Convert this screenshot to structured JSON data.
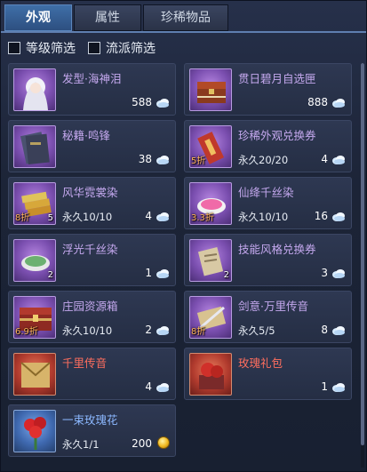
{
  "tabs": [
    {
      "label": "外观",
      "active": true
    },
    {
      "label": "属性",
      "active": false
    },
    {
      "label": "珍稀物品",
      "active": false
    }
  ],
  "filters": [
    {
      "label": "等级筛选",
      "checked": false
    },
    {
      "label": "流派筛选",
      "checked": false
    }
  ],
  "items": [
    {
      "name": "发型·海神泪",
      "rarity": "purple",
      "icon": "hair-portrait-icon",
      "badge": "",
      "count": "",
      "duration": "",
      "price": "588",
      "currency": "cloud-crystal-icon"
    },
    {
      "name": "贯日碧月自选匣",
      "rarity": "purple",
      "icon": "treasure-chest-icon",
      "badge": "",
      "count": "",
      "duration": "",
      "price": "888",
      "currency": "cloud-crystal-icon"
    },
    {
      "name": "秘籍·鸣锋",
      "rarity": "purple",
      "icon": "secret-book-icon",
      "badge": "",
      "count": "",
      "duration": "",
      "price": "38",
      "currency": "cloud-crystal-icon"
    },
    {
      "name": "珍稀外观兑换券",
      "rarity": "purple",
      "icon": "red-ticket-icon",
      "badge": "5折",
      "count": "",
      "duration": "永久20/20",
      "price": "4",
      "currency": "cloud-crystal-icon"
    },
    {
      "name": "风华霓裳染",
      "rarity": "purple",
      "icon": "dye-cloth-icon",
      "badge": "8折",
      "count": "5",
      "duration": "永久10/10",
      "price": "4",
      "currency": "cloud-crystal-icon"
    },
    {
      "name": "仙绛千丝染",
      "rarity": "purple",
      "icon": "dye-bowl-pink-icon",
      "badge": "3.3折",
      "count": "",
      "duration": "永久10/10",
      "price": "16",
      "currency": "cloud-crystal-icon"
    },
    {
      "name": "浮光千丝染",
      "rarity": "purple",
      "icon": "dye-bowl-green-icon",
      "badge": "",
      "count": "2",
      "duration": "",
      "price": "1",
      "currency": "cloud-crystal-icon"
    },
    {
      "name": "技能风格兑换券",
      "rarity": "purple",
      "icon": "paper-ticket-icon",
      "badge": "",
      "count": "2",
      "duration": "",
      "price": "3",
      "currency": "cloud-crystal-icon"
    },
    {
      "name": "庄园资源箱",
      "rarity": "purple",
      "icon": "resource-chest-icon",
      "badge": "6.9折",
      "count": "",
      "duration": "永久10/10",
      "price": "2",
      "currency": "cloud-crystal-icon"
    },
    {
      "name": "剑意·万里传音",
      "rarity": "purple",
      "icon": "sword-scroll-icon",
      "badge": "8折",
      "count": "",
      "duration": "永久5/5",
      "price": "8",
      "currency": "cloud-crystal-icon"
    },
    {
      "name": "千里传音",
      "rarity": "red",
      "icon": "letter-scroll-icon",
      "badge": "",
      "count": "",
      "duration": "",
      "price": "4",
      "currency": "cloud-crystal-icon"
    },
    {
      "name": "玫瑰礼包",
      "rarity": "red",
      "icon": "rose-gift-icon",
      "badge": "",
      "count": "",
      "duration": "",
      "price": "1",
      "currency": "cloud-crystal-icon"
    },
    {
      "name": "一束玫瑰花",
      "rarity": "blue",
      "icon": "rose-bouquet-icon",
      "badge": "",
      "count": "",
      "duration": "永久1/1",
      "price": "200",
      "currency": "gold-coin-icon"
    }
  ],
  "colors": {
    "rare_purple": "#c4a8ee",
    "rare_red": "#ff6e5e",
    "rare_blue": "#8cb8ff",
    "discount": "#ffb35a",
    "active_tab": "#3f6fa8"
  }
}
